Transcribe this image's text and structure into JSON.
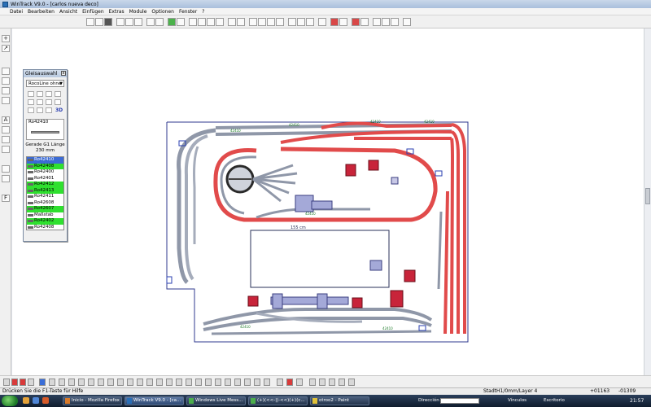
{
  "window": {
    "title": "WinTrack  V9.0 - [carlos nueva deco]"
  },
  "menu": [
    "Datei",
    "Bearbeiten",
    "Ansicht",
    "Einfügen",
    "Extras",
    "Module",
    "Optionen",
    "Fenster",
    "?"
  ],
  "left_tools": [
    "+",
    "↗",
    "A",
    "F"
  ],
  "palette": {
    "title": "Gleisauswahl",
    "close_label": "x",
    "system": "RocoLine ohne",
    "system_arrow": "▼",
    "icon_3d": "3D",
    "preview_code": "Ro42410",
    "desc_line1": "Gerade G1 Länge",
    "desc_line2": "230 mm",
    "list": [
      {
        "label": "Ro42410",
        "style": "sel"
      },
      {
        "label": "Ro42408",
        "style": "g"
      },
      {
        "label": "Ro42400",
        "style": ""
      },
      {
        "label": "Ro42401",
        "style": ""
      },
      {
        "label": "Ro42412",
        "style": "g"
      },
      {
        "label": "Ro42413",
        "style": "g"
      },
      {
        "label": "Ro42411",
        "style": ""
      },
      {
        "label": "Ro42608",
        "style": ""
      },
      {
        "label": "Ro42607",
        "style": "g"
      },
      {
        "label": "Maßstab",
        "style": ""
      },
      {
        "label": "Ro42402",
        "style": "g"
      },
      {
        "label": "Ro42408",
        "style": ""
      },
      {
        "label": "Ro42423",
        "style": "g"
      },
      {
        "label": "Ro42409",
        "style": ""
      },
      {
        "label": "Ro42424",
        "style": "g"
      }
    ]
  },
  "canvas": {
    "dimension_label": "155 cm",
    "track_code": "42410",
    "colors": {
      "track_red": "#e14b4b",
      "track_gray": "#8f97a8",
      "building_red": "#c8243a",
      "platform": "#a4a9d8",
      "board_border": "#2f3a8f"
    }
  },
  "status": {
    "hint": "Drücken Sie die F1-Taste für Hilfe",
    "layer": "StadtH1/0mm/Layer 4",
    "x": "+01163",
    "y": "-01309"
  },
  "taskbar": {
    "tasks": [
      {
        "label": "Inicio - Mozilla Firefox",
        "active": false
      },
      {
        "label": "WinTrack  V9.0 - [ca...",
        "active": true
      },
      {
        "label": "Windows Live Mess...",
        "active": false
      },
      {
        "label": "(+)(<<-||-<<)(+)(c...",
        "active": false
      },
      {
        "label": "otroo2 - Paint",
        "active": false
      }
    ],
    "address_label": "Dirección",
    "links_label": "Vínculos",
    "desktop_label": "Escritorio",
    "clock": "21:57"
  }
}
